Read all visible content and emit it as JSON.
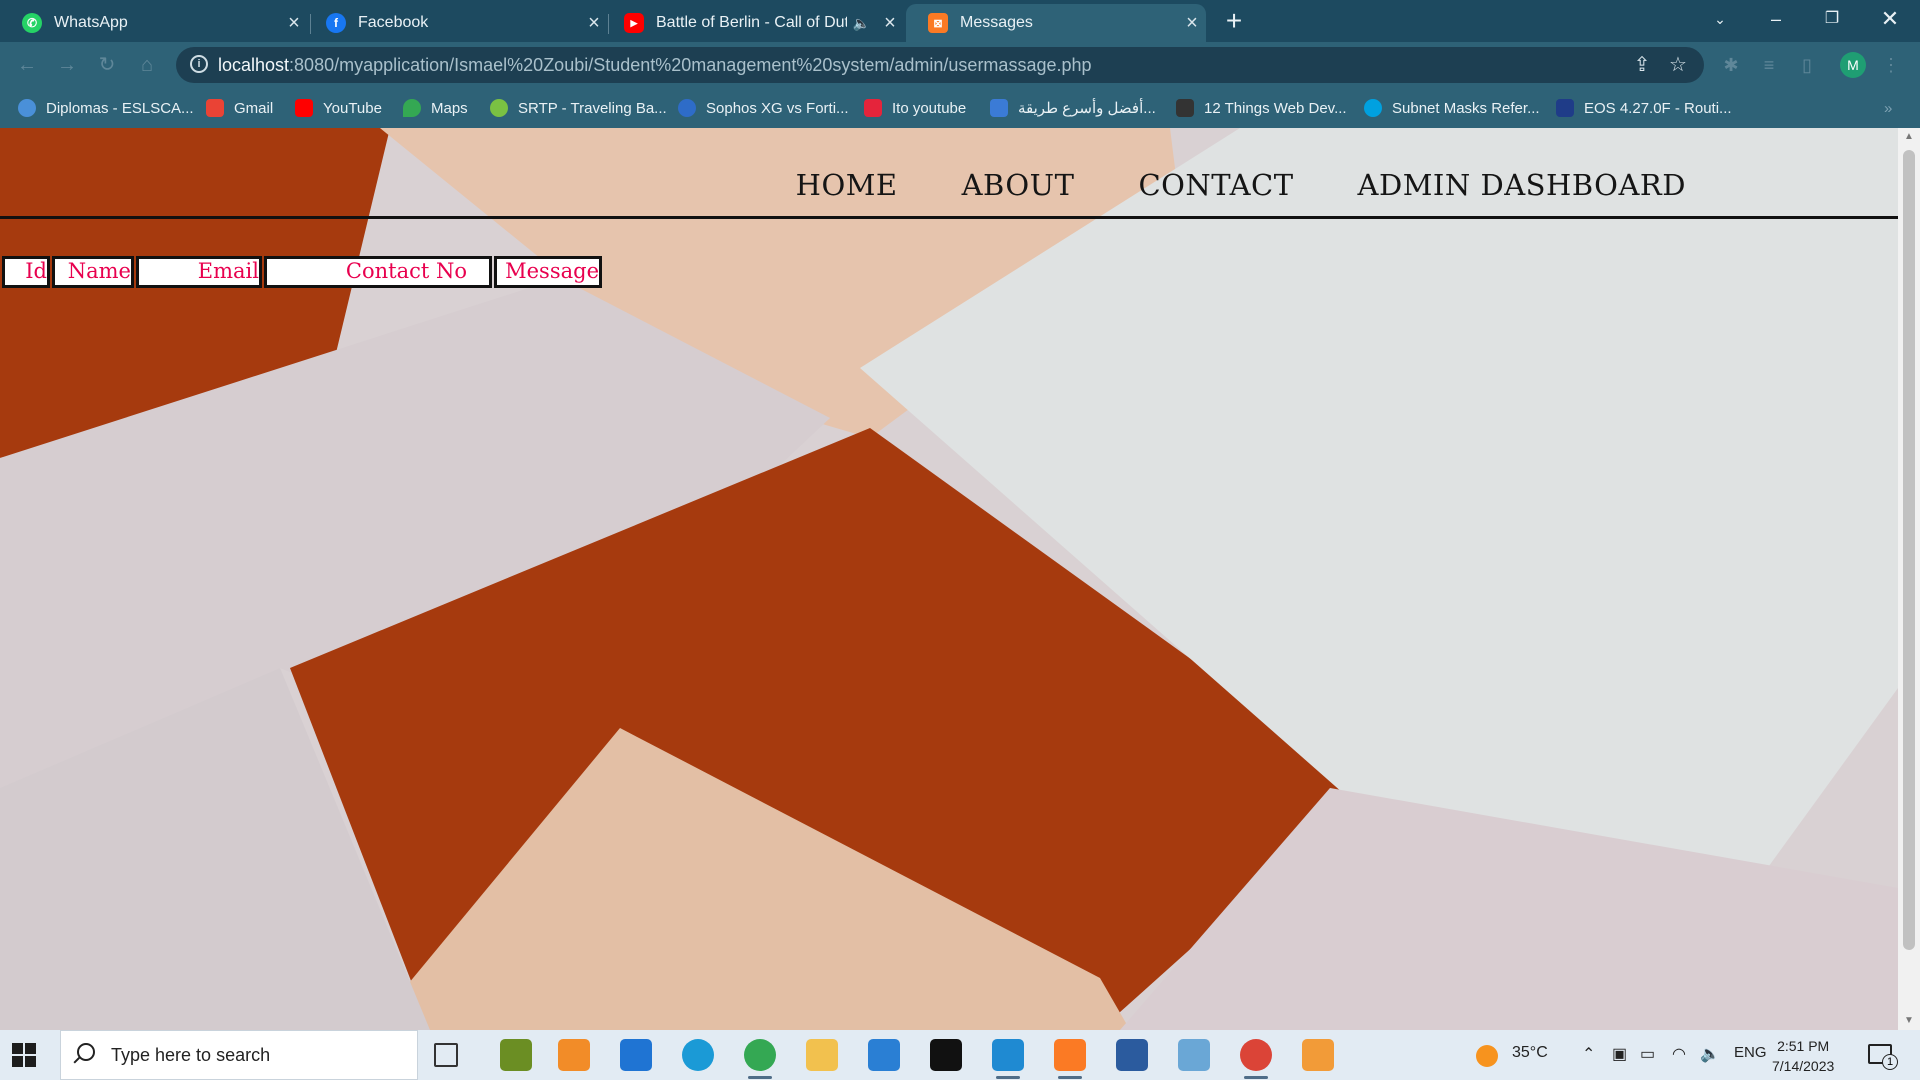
{
  "browser": {
    "tabs": [
      {
        "title": "WhatsApp",
        "icon": "whatsapp-icon",
        "color": "#25d366",
        "active": false
      },
      {
        "title": "Facebook",
        "icon": "facebook-icon",
        "color": "#1877f2",
        "active": false
      },
      {
        "title": "Battle of Berlin - Call of Duty",
        "icon": "youtube-icon",
        "color": "#ff0000",
        "active": false
      },
      {
        "title": "Messages",
        "icon": "xampp-icon",
        "color": "#fb7a24",
        "active": true
      }
    ],
    "url_host": "localhost",
    "url_rest": ":8080/myapplication/Ismael%20Zoubi/Student%20management%20system/admin/usermassage.php",
    "profile_initial": "M",
    "bookmarks": [
      {
        "label": "Diplomas - ESLSCA...",
        "color": "#4a90d9"
      },
      {
        "label": "Gmail",
        "color": "#ea4335"
      },
      {
        "label": "YouTube",
        "color": "#ff0000"
      },
      {
        "label": "Maps",
        "color": "#34a853"
      },
      {
        "label": "SRTP - Traveling Ba...",
        "color": "#7ac143"
      },
      {
        "label": "Sophos XG vs Forti...",
        "color": "#2e6cc8"
      },
      {
        "label": "Ito youtube",
        "color": "#e5243b"
      },
      {
        "label": "أفضل وأسرع طريقة...",
        "color": "#3b7bd6"
      },
      {
        "label": "12 Things Web Dev...",
        "color": "#333333"
      },
      {
        "label": "Subnet Masks Refer...",
        "color": "#00a1e0"
      },
      {
        "label": "EOS 4.27.0F - Routi...",
        "color": "#1f3c88"
      }
    ]
  },
  "site": {
    "nav": [
      "HOME",
      "ABOUT",
      "CONTACT",
      "ADMIN DASHBOARD"
    ],
    "table_headers": [
      "Id",
      "Name",
      "Email",
      "Contact No",
      "Message"
    ],
    "background_colors": [
      "#a63a0e",
      "#e6c4ad",
      "#d9d1d3",
      "#dfe2e2"
    ]
  },
  "taskbar": {
    "search_placeholder": "Type here to search",
    "weather": "35°C",
    "language": "ENG",
    "time": "2:51 PM",
    "date": "7/14/2023",
    "notification_count": "1",
    "apps": [
      {
        "name": "task-view-icon",
        "color": "#333333"
      },
      {
        "name": "paint-icon",
        "color": "#6b8e23"
      },
      {
        "name": "remote-desktop-icon",
        "color": "#f28c28"
      },
      {
        "name": "mail-icon",
        "color": "#1f74d3"
      },
      {
        "name": "edge-icon",
        "color": "#1b9ad6"
      },
      {
        "name": "chrome-profile-icon",
        "color": "#34a853"
      },
      {
        "name": "file-explorer-icon",
        "color": "#f2c14e"
      },
      {
        "name": "video-editor-icon",
        "color": "#2a7fd4"
      },
      {
        "name": "terminal-icon",
        "color": "#111111"
      },
      {
        "name": "vscode-icon",
        "color": "#1f8ad2"
      },
      {
        "name": "xampp-icon",
        "color": "#fb7a24"
      },
      {
        "name": "sql-server-icon",
        "color": "#2b5b9e"
      },
      {
        "name": "notes-icon",
        "color": "#6aa7d6"
      },
      {
        "name": "chrome-icon",
        "color": "#db4437"
      },
      {
        "name": "media-player-icon",
        "color": "#f29b38"
      }
    ]
  }
}
